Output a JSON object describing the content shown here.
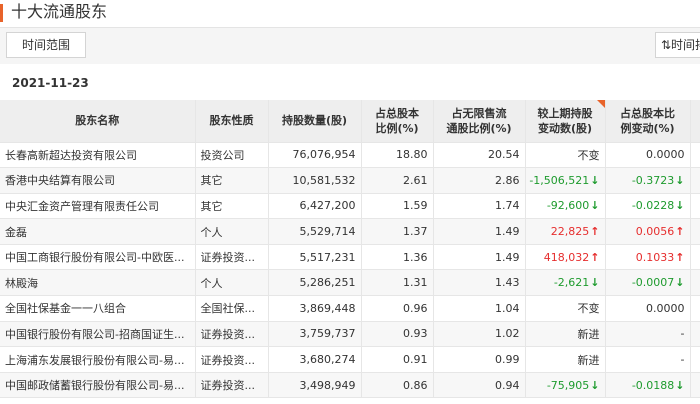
{
  "header": {
    "title": "十大流通股东"
  },
  "toolbar": {
    "range_label": "时间范围",
    "sort_label": "⇅时间排"
  },
  "date": "2021-11-23",
  "columns": [
    "股东名称",
    "股东性质",
    "持股数量(股)",
    "占总股本\n比例(%)",
    "占无限售流\n通股比例(%)",
    "较上期持股\n变动数(股)",
    "占总股本比\n例变动(%)"
  ],
  "rows": [
    {
      "name": "长春高新超达投资有限公司",
      "nature": "投资公司",
      "shares": "76,076,954",
      "total_pct": "18.80",
      "float_pct": "20.54",
      "change": "不变",
      "change_pct": "0.0000",
      "dir": "none"
    },
    {
      "name": "香港中央结算有限公司",
      "nature": "其它",
      "shares": "10,581,532",
      "total_pct": "2.61",
      "float_pct": "2.86",
      "change": "-1,506,521",
      "change_pct": "-0.3723",
      "dir": "down"
    },
    {
      "name": "中央汇金资产管理有限责任公司",
      "nature": "其它",
      "shares": "6,427,200",
      "total_pct": "1.59",
      "float_pct": "1.74",
      "change": "-92,600",
      "change_pct": "-0.0228",
      "dir": "down"
    },
    {
      "name": "金磊",
      "nature": "个人",
      "shares": "5,529,714",
      "total_pct": "1.37",
      "float_pct": "1.49",
      "change": "22,825",
      "change_pct": "0.0056",
      "dir": "up"
    },
    {
      "name": "中国工商银行股份有限公司-中欧医...",
      "nature": "证券投资...",
      "shares": "5,517,231",
      "total_pct": "1.36",
      "float_pct": "1.49",
      "change": "418,032",
      "change_pct": "0.1033",
      "dir": "up"
    },
    {
      "name": "林殿海",
      "nature": "个人",
      "shares": "5,286,251",
      "total_pct": "1.31",
      "float_pct": "1.43",
      "change": "-2,621",
      "change_pct": "-0.0007",
      "dir": "down"
    },
    {
      "name": "全国社保基金一一八组合",
      "nature": "全国社保...",
      "shares": "3,869,448",
      "total_pct": "0.96",
      "float_pct": "1.04",
      "change": "不变",
      "change_pct": "0.0000",
      "dir": "none"
    },
    {
      "name": "中国银行股份有限公司-招商国证生...",
      "nature": "证券投资...",
      "shares": "3,759,737",
      "total_pct": "0.93",
      "float_pct": "1.02",
      "change": "新进",
      "change_pct": "-",
      "dir": "none"
    },
    {
      "name": "上海浦东发展银行股份有限公司-易...",
      "nature": "证券投资...",
      "shares": "3,680,274",
      "total_pct": "0.91",
      "float_pct": "0.99",
      "change": "新进",
      "change_pct": "-",
      "dir": "none"
    },
    {
      "name": "中国邮政储蓄银行股份有限公司-易...",
      "nature": "证券投资...",
      "shares": "3,498,949",
      "total_pct": "0.86",
      "float_pct": "0.94",
      "change": "-75,905",
      "change_pct": "-0.0188",
      "dir": "down"
    }
  ],
  "icons": {
    "up": "arrow-up-icon",
    "down": "arrow-down-icon"
  },
  "colors": {
    "accent": "#e8632a",
    "up": "#e62e2e",
    "down": "#1e9b2e"
  }
}
